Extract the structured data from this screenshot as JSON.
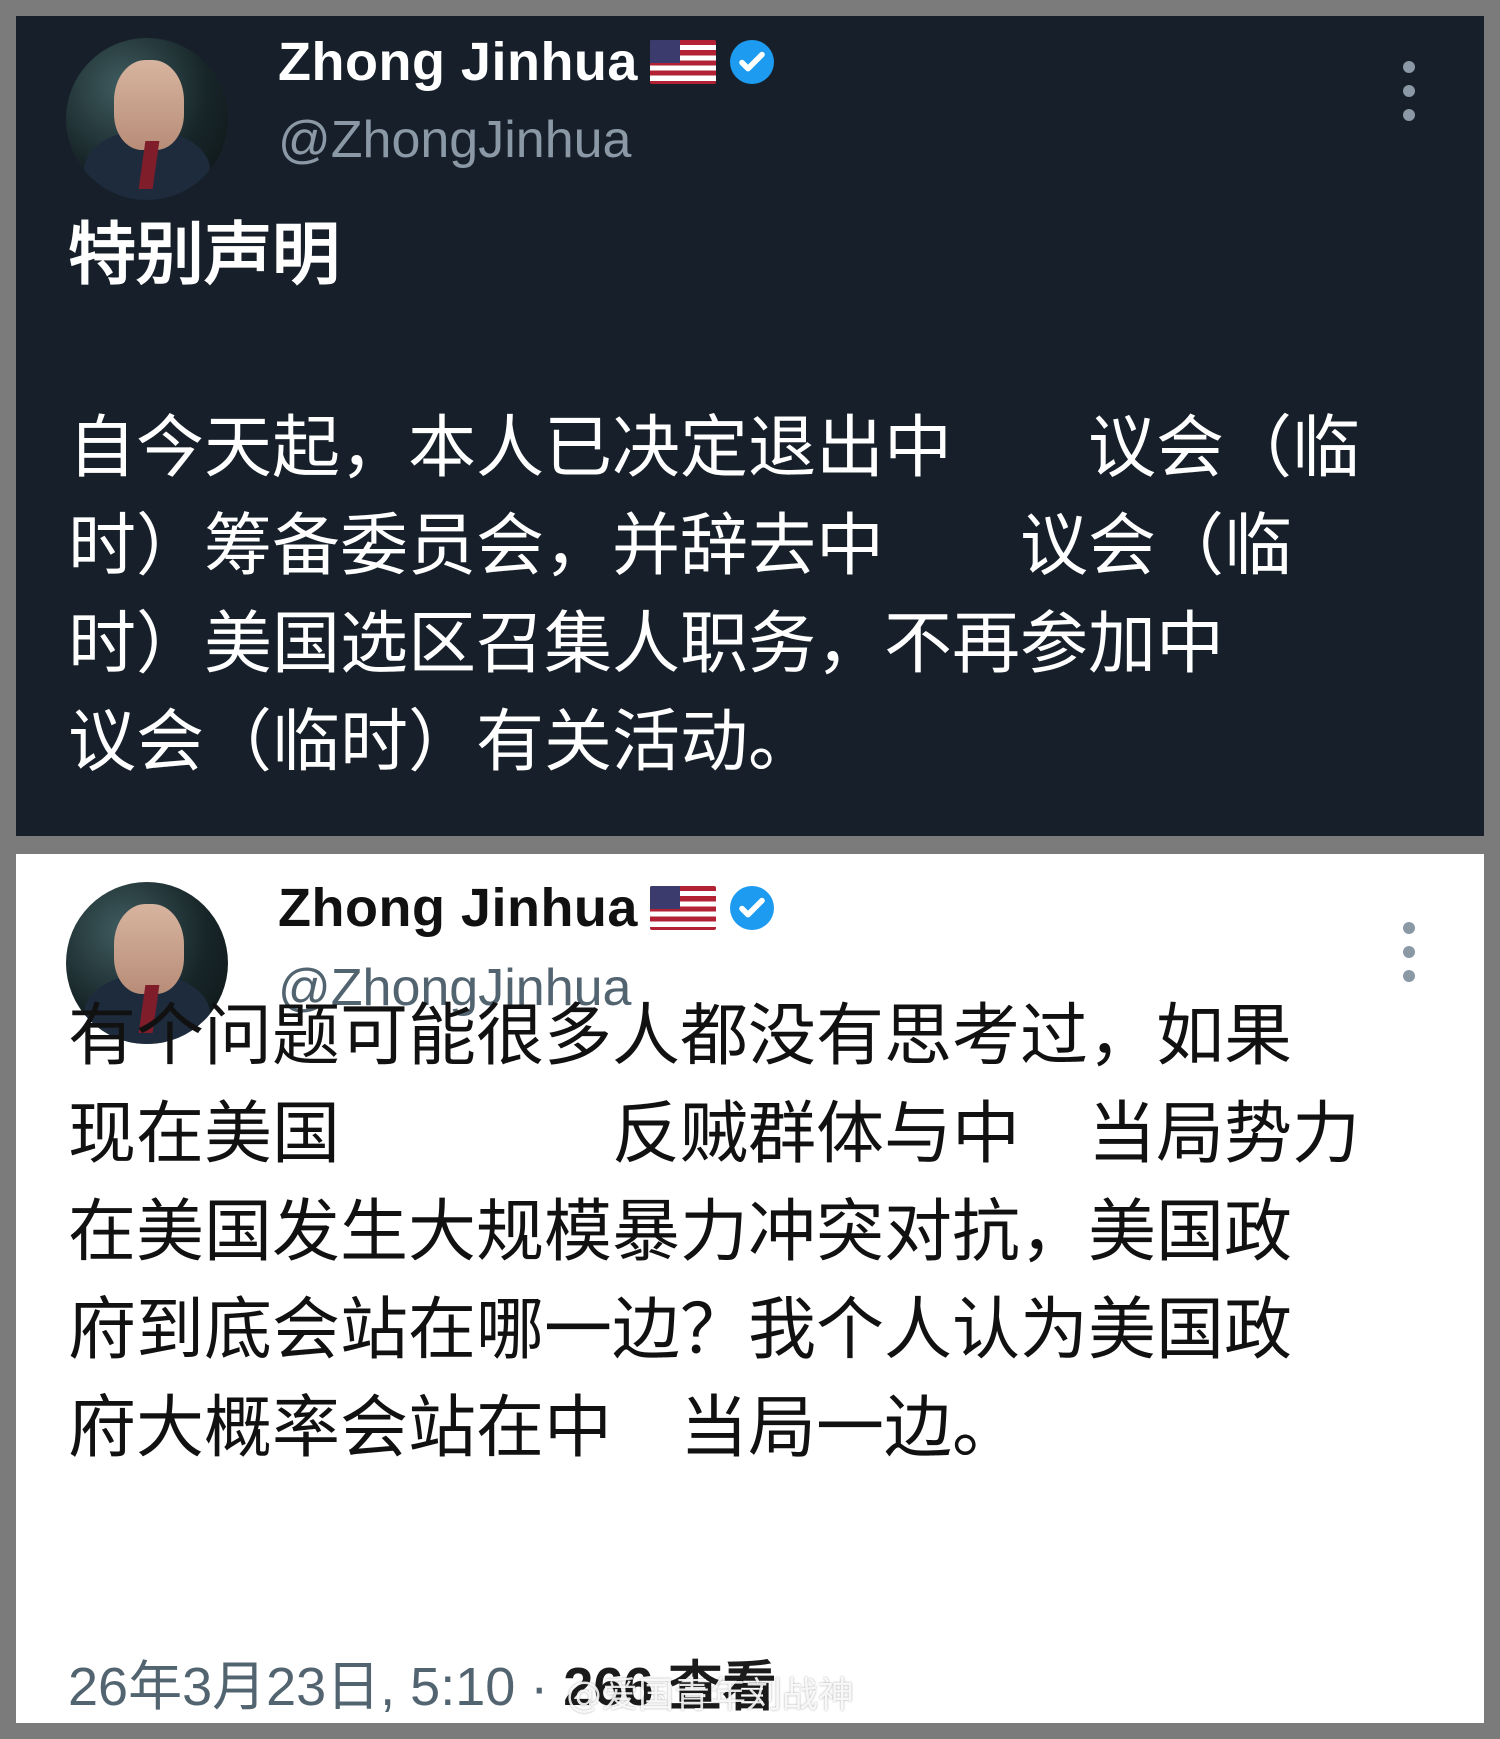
{
  "cards": [
    {
      "theme": "dark",
      "account": {
        "display_name": "Zhong Jinhua",
        "handle": "@ZhongJinhua",
        "verified": true,
        "flag_icon": "us-flag-icon",
        "verified_icon": "verified-badge-icon",
        "menu_icon": "more-vert-icon"
      },
      "title": "特别声明",
      "body": {
        "line1": "自今天起，本人已决定退出中　　议会（临",
        "line2": "时）筹备委员会，并辞去中　　议会（临",
        "line3": "时）美国选区召集人职务，不再参加中",
        "line4": "议会（临时）有关活动。"
      }
    },
    {
      "theme": "light",
      "account": {
        "display_name": "Zhong Jinhua",
        "handle": "@ZhongJinhua",
        "verified": true,
        "flag_icon": "us-flag-icon",
        "verified_icon": "verified-badge-icon",
        "menu_icon": "more-vert-icon"
      },
      "body": {
        "line1": "有个问题可能很多人都没有思考过，如果",
        "line2": "现在美国　　　　反贼群体与中　当局势力",
        "line3": "在美国发生大规模暴力冲突对抗，美国政",
        "line4": "府到底会站在哪一边？我个人认为美国政",
        "line5": "府大概率会站在中　当局一边。"
      },
      "timestamp": "26年3月23日, 5:10 ·",
      "views": "266 查看"
    }
  ],
  "watermark": "@爱国青年刘战神"
}
